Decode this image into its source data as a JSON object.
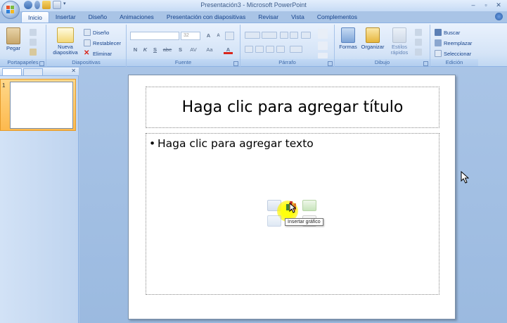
{
  "window": {
    "title": "Presentación3 - Microsoft PowerPoint"
  },
  "tabs": [
    "Inicio",
    "Insertar",
    "Diseño",
    "Animaciones",
    "Presentación con diapositivas",
    "Revisar",
    "Vista",
    "Complementos"
  ],
  "ribbon": {
    "portapapeles": {
      "label": "Portapapeles",
      "paste": "Pegar"
    },
    "diapositivas": {
      "label": "Diapositivas",
      "new_slide_line1": "Nueva",
      "new_slide_line2": "diapositiva",
      "layout": "Diseño",
      "reset": "Restablecer",
      "delete": "Eliminar"
    },
    "fuente": {
      "label": "Fuente",
      "font_name": "",
      "font_size": "32",
      "bold": "N",
      "italic": "K",
      "underline": "S",
      "strike": "abe",
      "shadow": "S",
      "spacing": "AV",
      "case": "Aa",
      "grow": "A",
      "shrink": "A",
      "font_color": "A"
    },
    "parrafo": {
      "label": "Párrafo"
    },
    "dibujo": {
      "label": "Dibujo",
      "shapes": "Formas",
      "arrange": "Organizar",
      "quick_styles_line1": "Estilos",
      "quick_styles_line2": "rápidos"
    },
    "edicion": {
      "label": "Edición",
      "find": "Buscar",
      "replace": "Reemplazar",
      "select": "Seleccionar"
    }
  },
  "slides_pane": {
    "slide_number": "1"
  },
  "slide": {
    "title_placeholder": "Haga clic para agregar título",
    "body_placeholder": "Haga clic para agregar texto",
    "bullet": "•"
  },
  "tooltip": "Insertar gráfico",
  "colors": {
    "ribbon_bg": "#d5e4f7",
    "workspace_bg": "#a9c4e6",
    "selected_thumb": "#fdb94e",
    "highlight": "#ffff00"
  }
}
